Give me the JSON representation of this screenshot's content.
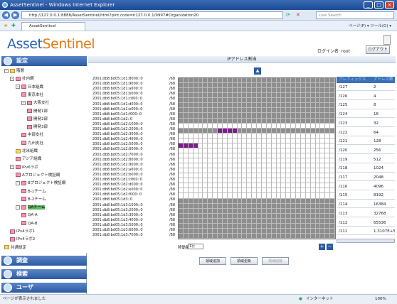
{
  "window": {
    "title": "AssetSentinel - Windows Internet Explorer"
  },
  "browser": {
    "address": "http://127.0.0.1:8888/AssetSentinel/html?pint.code=n127.0.0.1/9997#Organization20",
    "search_placeholder": "Live Search",
    "tab_label": "AssetSentinel",
    "toolbar_text": "ページ(P) ▾  ツール(O) ▾"
  },
  "app": {
    "logo_a": "Asset",
    "logo_b": "Sentinel",
    "login_label": "ログイン名",
    "login_user": "root",
    "logout_label": "ログアウト"
  },
  "sidebar": {
    "sections": [
      "設定",
      "調査",
      "検索",
      "ユーザ"
    ],
    "tree": [
      {
        "label": "階層",
        "lvl": 0,
        "ex": "-",
        "icon": "fo"
      },
      {
        "label": "社内網",
        "lvl": 1,
        "ex": "-",
        "icon": "fi"
      },
      {
        "label": "日本組織",
        "lvl": 2,
        "ex": "-",
        "icon": "fi"
      },
      {
        "label": "東京本社",
        "lvl": 3,
        "ex": "",
        "icon": "fi"
      },
      {
        "label": "大阪支社",
        "lvl": 3,
        "ex": "-",
        "icon": "fi"
      },
      {
        "label": "開発1部",
        "lvl": 4,
        "ex": "",
        "icon": "fi"
      },
      {
        "label": "開発2部",
        "lvl": 4,
        "ex": "",
        "icon": "fi"
      },
      {
        "label": "開発3部",
        "lvl": 4,
        "ex": "",
        "icon": "fi"
      },
      {
        "label": "中部支社",
        "lvl": 3,
        "ex": "",
        "icon": "fi"
      },
      {
        "label": "九州支社",
        "lvl": 3,
        "ex": "",
        "icon": "fi"
      },
      {
        "label": "北米組織",
        "lvl": 2,
        "ex": "",
        "icon": "fo"
      },
      {
        "label": "アジア組織",
        "lvl": 2,
        "ex": "",
        "icon": "fi"
      },
      {
        "label": "IPv6ラボ",
        "lvl": 1,
        "ex": "-",
        "icon": "fi"
      },
      {
        "label": "Aプロジェクト検証網",
        "lvl": 2,
        "ex": "",
        "icon": "fi"
      },
      {
        "label": "Bプロジェクト検証網",
        "lvl": 2,
        "ex": "-",
        "icon": "fi"
      },
      {
        "label": "B-1チーム",
        "lvl": 3,
        "ex": "",
        "icon": "fi"
      },
      {
        "label": "B-2チーム",
        "lvl": 3,
        "ex": "",
        "icon": "fi"
      },
      {
        "label": "QAチーム",
        "lvl": 2,
        "ex": "-",
        "icon": "fi",
        "sel": true
      },
      {
        "label": "QA-A",
        "lvl": 3,
        "ex": "",
        "icon": "fi"
      },
      {
        "label": "QA-B",
        "lvl": 3,
        "ex": "",
        "icon": "fi"
      },
      {
        "label": "IPv4ラボ1",
        "lvl": 1,
        "ex": "",
        "icon": "fi"
      },
      {
        "label": "IPv4ラボ2",
        "lvl": 1,
        "ex": "",
        "icon": "fi"
      },
      {
        "label": "共通設定",
        "lvl": 0,
        "ex": "",
        "icon": "fo"
      }
    ]
  },
  "main": {
    "panel_title": "IPアドレス割当",
    "ip_rows": [
      "2001:db8:bd05:1d1:8000::0",
      "2001:db8:bd05:1d1:9000::0",
      "2001:db8:bd05:1d1:a000::0",
      "2001:db8:bd05:1d1:b000::0",
      "2001:db8:bd05:1d1:c000::0",
      "2001:db8:bd05:1d1:d000::0",
      "2001:db8:bd05:1d1:e000::0",
      "2001:db8:bd05:1d1:f000::0",
      "2001:db8:bd05:1d2::0",
      "2001:db8:bd05:1d2:1000::0",
      "2001:db8:bd05:1d2:2000::0",
      "2001:db8:bd05:1d2:3000::0",
      "2001:db8:bd05:1d2:4000::0",
      "2001:db8:bd05:1d2:5000::0",
      "2001:db8:bd05:1d2:6000::0",
      "2001:db8:bd05:1d2:7000::0",
      "2001:db8:bd05:1d2:8000::0",
      "2001:db8:bd05:1d2:9000::0",
      "2001:db8:bd05:1d2:a000::0",
      "2001:db8:bd05:1d2:b000::0",
      "2001:db8:bd05:1d2:c000::0",
      "2001:db8:bd05:1d2:d000::0",
      "2001:db8:bd05:1d2:e000::0",
      "2001:db8:bd05:1d2:f000::0",
      "2001:db8:bd05:1d3::0",
      "2001:db8:bd05:1d3:1000::0",
      "2001:db8:bd05:1d3:2000::0",
      "2001:db8:bd05:1d3:3000::0",
      "2001:db8:bd05:1d3:4000::0",
      "2001:db8:bd05:1d3:5000::0",
      "2001:db8:bd05:1d3:6000::0",
      "2001:db8:bd05:1d3:7000::0"
    ],
    "prefix_suffix": "/68",
    "table_headers": [
      "プレフィックス",
      "アドレス数"
    ],
    "table_rows": [
      [
        "/127",
        "2"
      ],
      [
        "/126",
        "4"
      ],
      [
        "/125",
        "8"
      ],
      [
        "/124",
        "16"
      ],
      [
        "/123",
        "32"
      ],
      [
        "/122",
        "64"
      ],
      [
        "/121",
        "128"
      ],
      [
        "/120",
        "256"
      ],
      [
        "/119",
        "512"
      ],
      [
        "/118",
        "1024"
      ],
      [
        "/117",
        "2048"
      ],
      [
        "/116",
        "4096"
      ],
      [
        "/115",
        "8192"
      ],
      [
        "/114",
        "16384"
      ],
      [
        "/113",
        "32768"
      ],
      [
        "/112",
        "65536"
      ],
      [
        "/111",
        "1.3107E+5"
      ]
    ],
    "legend_label": "移動量",
    "legend_value": "1行",
    "buttons": [
      "領域追加",
      "領域更新",
      "領域削除"
    ]
  },
  "status": {
    "left": "ページが表示されました",
    "zone": "インターネット",
    "zoom": "100%"
  },
  "colors": {
    "accent": "#2d5aa0",
    "grid_gray": "#8e8e8e",
    "grid_purple": "#7a1e8a"
  }
}
